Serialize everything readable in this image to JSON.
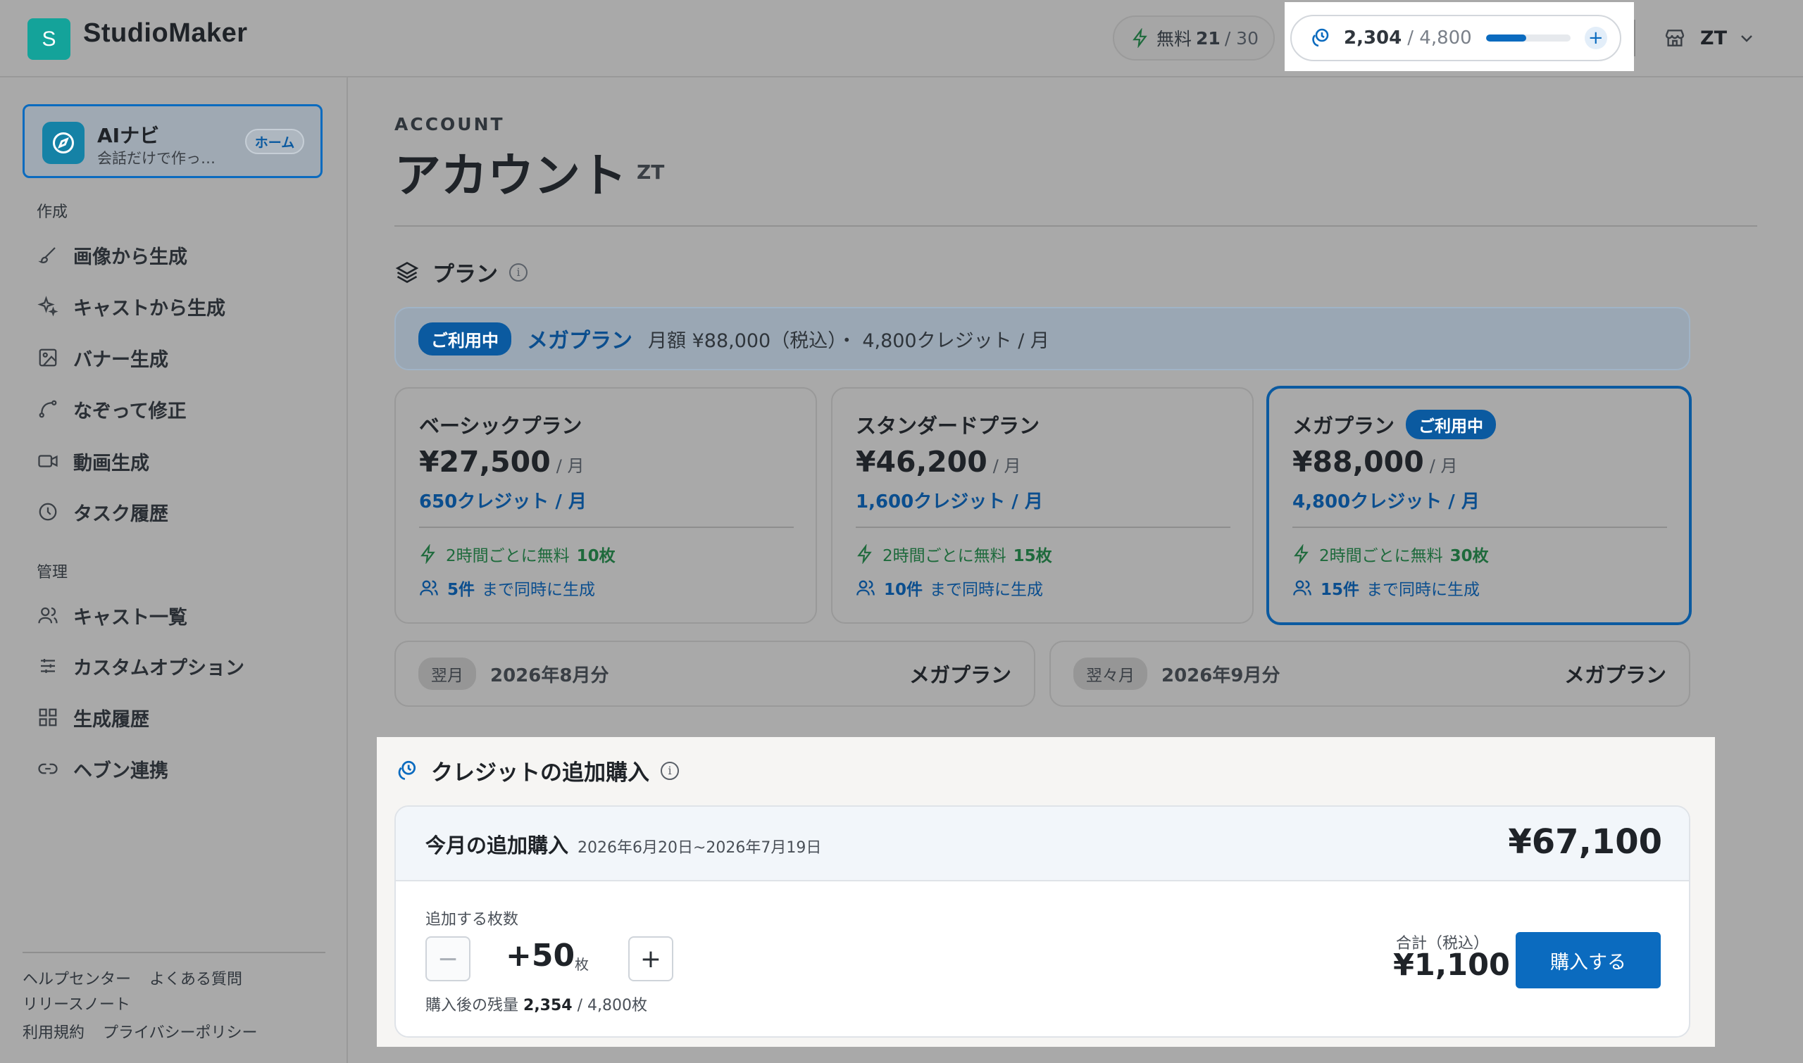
{
  "app": {
    "logo_letter": "S",
    "name": "StudioMaker"
  },
  "header": {
    "free": {
      "label": "無料",
      "value": "21",
      "max": "/ 30"
    },
    "credits": {
      "value": "2,304",
      "max": "/ 4,800",
      "fill_fraction": 0.48
    },
    "user": {
      "initials": "ZT"
    }
  },
  "sidebar": {
    "ai": {
      "title": "AIナビ",
      "subtitle": "会話だけで作っ…",
      "home_badge": "ホーム"
    },
    "create_label": "作成",
    "create_items": [
      "画像から生成",
      "キャストから生成",
      "バナー生成",
      "なぞって修正",
      "動画生成",
      "タスク履歴"
    ],
    "manage_label": "管理",
    "manage_items": [
      "キャスト一覧",
      "カスタムオプション",
      "生成履歴",
      "ヘブン連携"
    ],
    "footer": {
      "help": "ヘルプセンター",
      "faq": "よくある質問",
      "release": "リリースノート",
      "terms": "利用規約",
      "privacy": "プライバシーポリシー"
    }
  },
  "page": {
    "eyebrow": "ACCOUNT",
    "title": "アカウント",
    "user": "ZT"
  },
  "plan_section": {
    "title": "プラン",
    "current": {
      "badge": "ご利用中",
      "name": "メガプラン",
      "detail": "月額 ¥88,000（税込）・ 4,800クレジット / 月"
    },
    "plans": [
      {
        "name": "ベーシックプラン",
        "price": "¥27,500",
        "per": "/ 月",
        "credits": "650クレジット / 月",
        "free_text": "2時間ごとに無料",
        "free_count": "10枚",
        "concurrent": "5件",
        "concurrent_text": "まで同時に生成"
      },
      {
        "name": "スタンダードプラン",
        "price": "¥46,200",
        "per": "/ 月",
        "credits": "1,600クレジット / 月",
        "free_text": "2時間ごとに無料",
        "free_count": "15枚",
        "concurrent": "10件",
        "concurrent_text": "まで同時に生成"
      },
      {
        "name": "メガプラン",
        "badge": "ご利用中",
        "price": "¥88,000",
        "per": "/ 月",
        "credits": "4,800クレジット / 月",
        "free_text": "2時間ごとに無料",
        "free_count": "30枚",
        "concurrent": "15件",
        "concurrent_text": "まで同時に生成"
      }
    ],
    "upcoming": [
      {
        "tag": "翌月",
        "month": "2026年8月分",
        "plan": "メガプラン"
      },
      {
        "tag": "翌々月",
        "month": "2026年9月分",
        "plan": "メガプラン"
      }
    ]
  },
  "purchase_section": {
    "title": "クレジットの追加購入",
    "month_label": "今月の追加購入",
    "range": "2026年6月20日~2026年7月19日",
    "month_total": "¥67,100",
    "qty_label": "追加する枚数",
    "minus": "−",
    "plus": "+",
    "qty_value": "+50",
    "qty_unit": "枚",
    "after_prefix": "購入後の残量",
    "after_value": "2,354",
    "after_suffix": "/ 4,800枚",
    "total_label": "合計（税込）",
    "total_value": "¥1,100",
    "buy_button": "購入する"
  }
}
